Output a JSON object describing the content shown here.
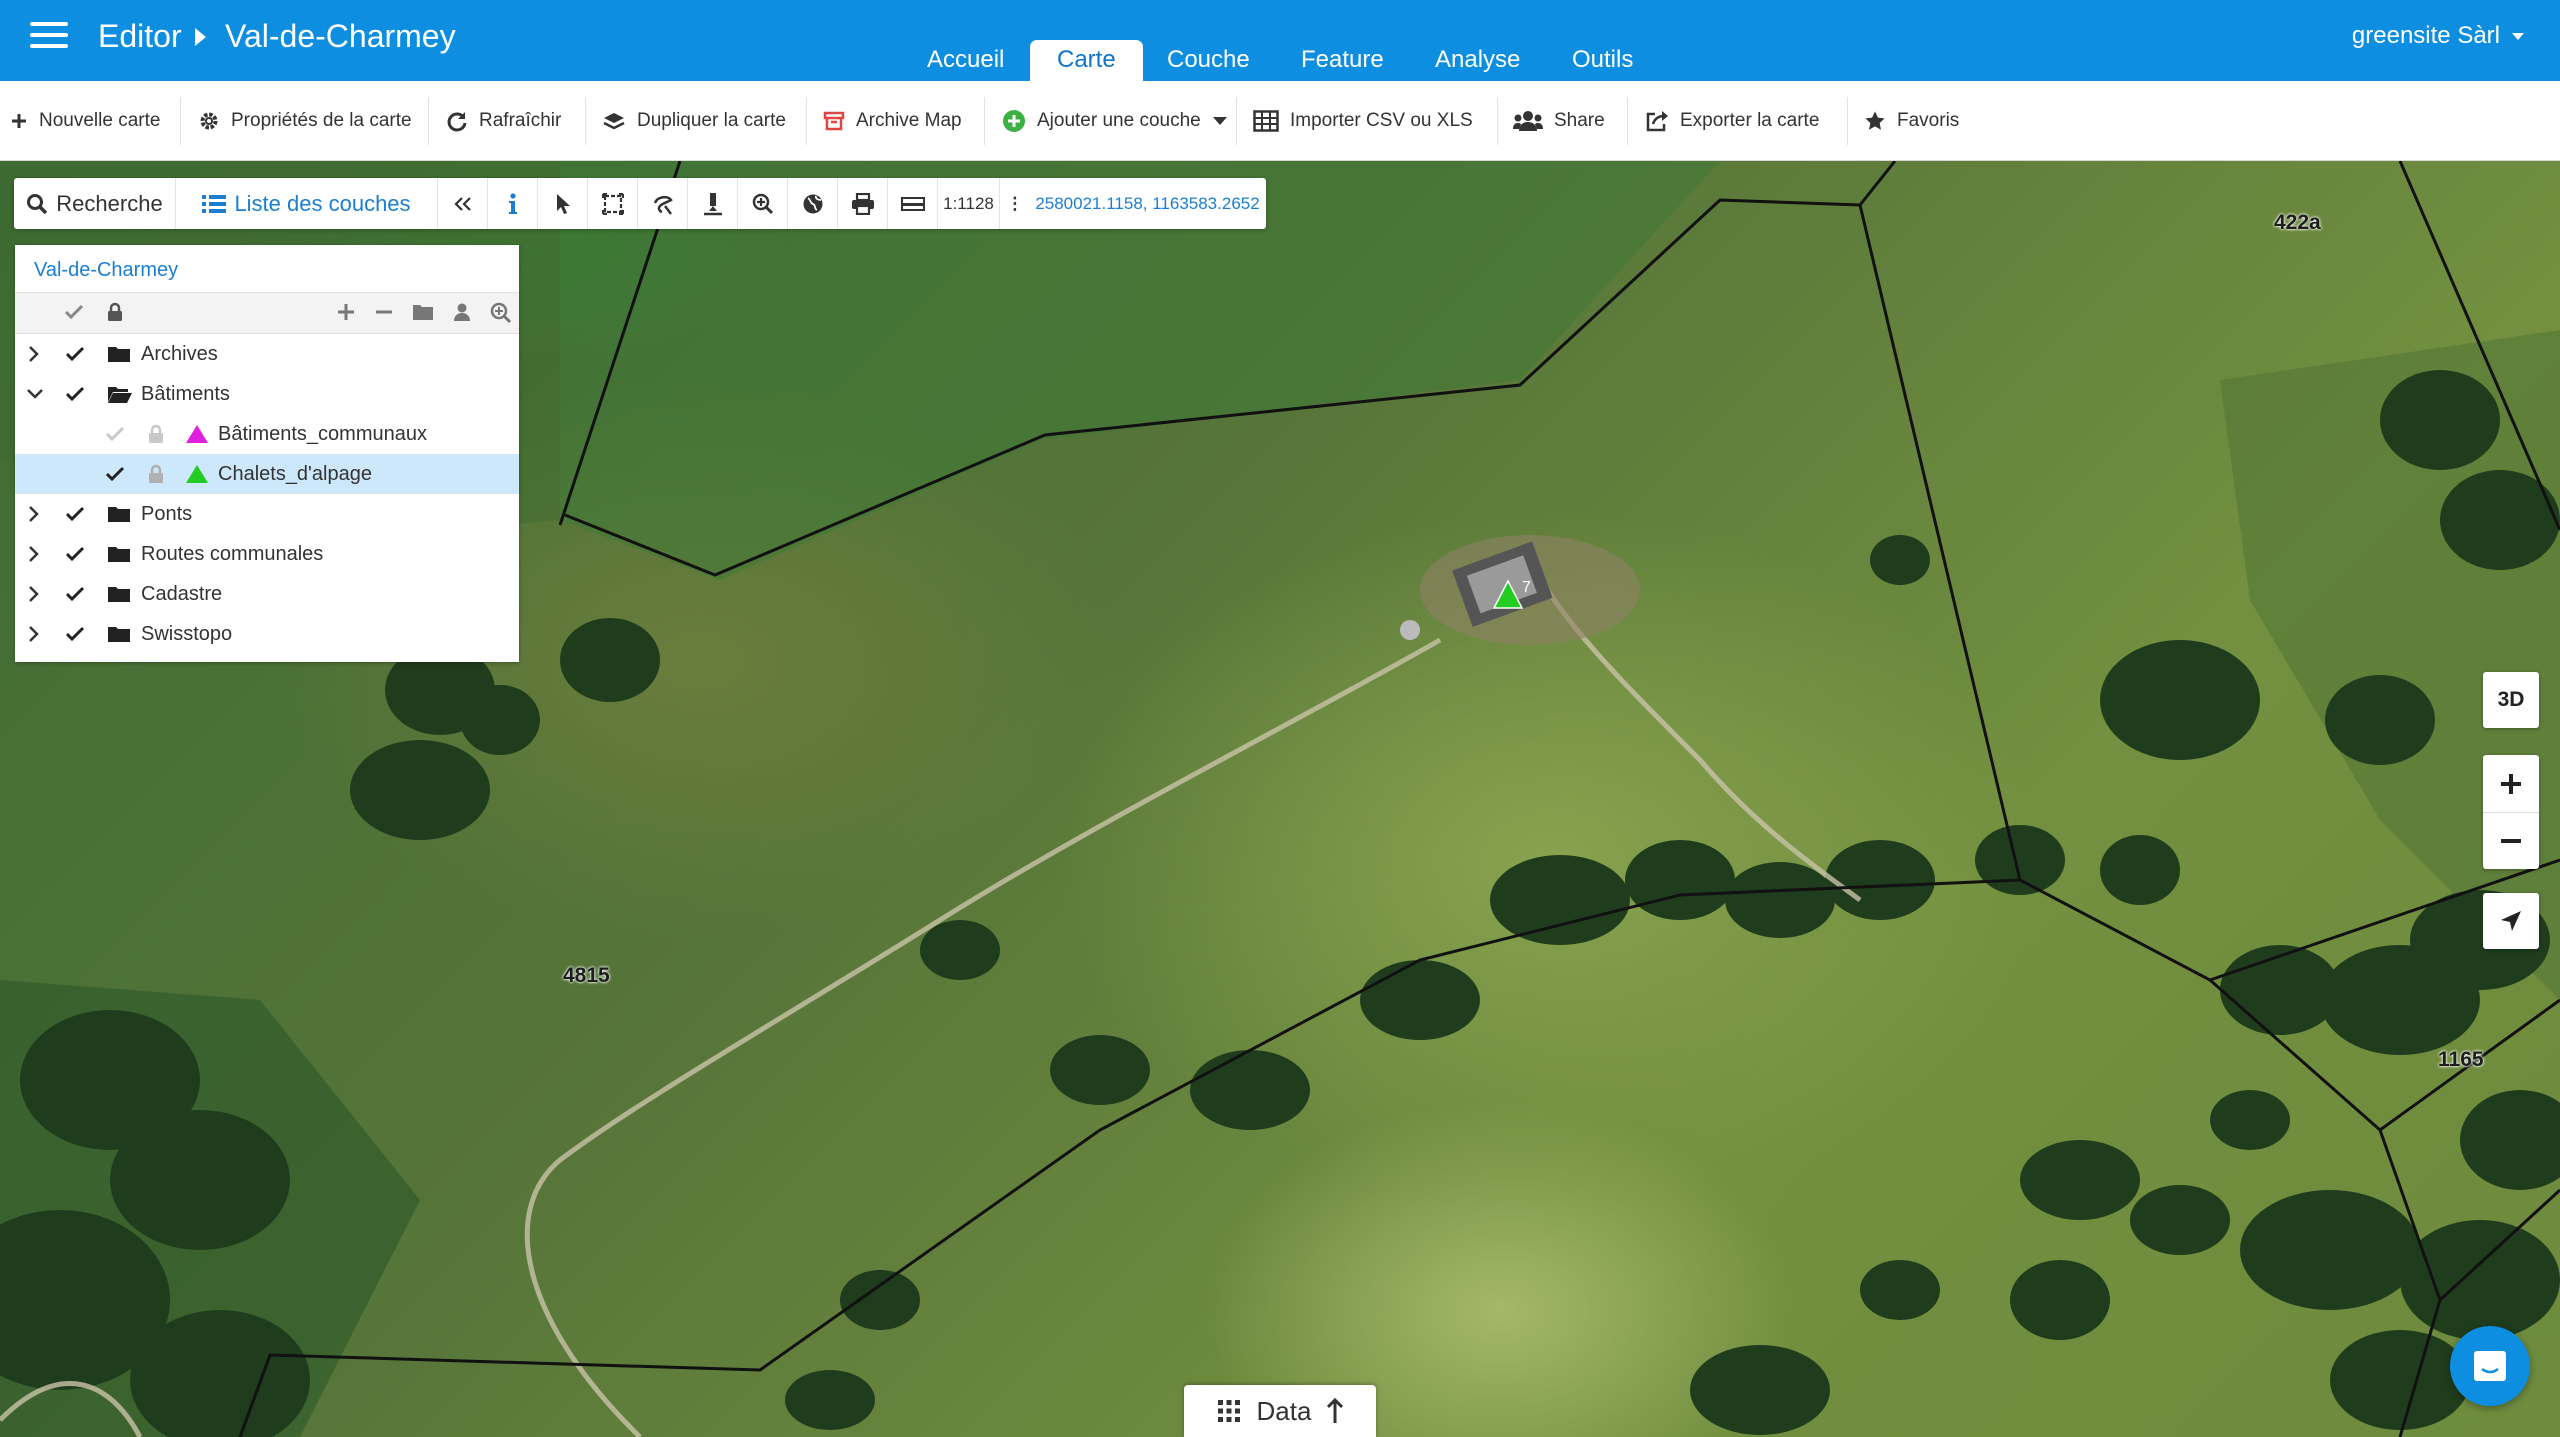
{
  "header": {
    "app_name": "Editor",
    "map_name": "Val-de-Charmey",
    "tabs": [
      {
        "label": "Accueil",
        "active": false
      },
      {
        "label": "Carte",
        "active": true
      },
      {
        "label": "Couche",
        "active": false
      },
      {
        "label": "Feature",
        "active": false
      },
      {
        "label": "Analyse",
        "active": false
      },
      {
        "label": "Outils",
        "active": false
      }
    ],
    "user": "greensite Sàrl"
  },
  "toolbar": {
    "new_map": "Nouvelle carte",
    "map_properties": "Propriétés de la carte",
    "refresh": "Rafraîchir",
    "duplicate": "Dupliquer la carte",
    "archive": "Archive Map",
    "add_layer": "Ajouter une couche",
    "import": "Importer CSV ou XLS",
    "share": "Share",
    "export": "Exporter la carte",
    "favorites": "Favoris"
  },
  "maptools": {
    "search": "Recherche",
    "layer_list": "Liste des couches",
    "scale": "1:1128",
    "coordinates": "2580021.1158, 1163583.2652"
  },
  "layer_panel": {
    "title": "Val-de-Charmey",
    "layers": [
      {
        "label": "Archives",
        "type": "folder",
        "expanded": false,
        "checked": true
      },
      {
        "label": "Bâtiments",
        "type": "folder",
        "expanded": true,
        "checked": true
      },
      {
        "label": "Bâtiments_communaux",
        "type": "layer",
        "checked": false,
        "symbol_color": "#e020e0"
      },
      {
        "label": "Chalets_d'alpage",
        "type": "layer",
        "checked": true,
        "selected": true,
        "symbol_color": "#22cc22"
      },
      {
        "label": "Ponts",
        "type": "folder",
        "expanded": false,
        "checked": true
      },
      {
        "label": "Routes communales",
        "type": "folder",
        "expanded": false,
        "checked": true
      },
      {
        "label": "Cadastre",
        "type": "folder",
        "expanded": false,
        "checked": true
      },
      {
        "label": "Swisstopo",
        "type": "folder",
        "expanded": false,
        "checked": true
      }
    ]
  },
  "map": {
    "parcels": [
      "422a",
      "4815",
      "1165"
    ],
    "feature_label": "7"
  },
  "map_controls": {
    "three_d": "3D"
  },
  "data_panel": {
    "label": "Data"
  },
  "colors": {
    "header_blue": "#0e8ee0",
    "link_blue": "#1a7fd4",
    "selected_row": "#cde7fb"
  }
}
